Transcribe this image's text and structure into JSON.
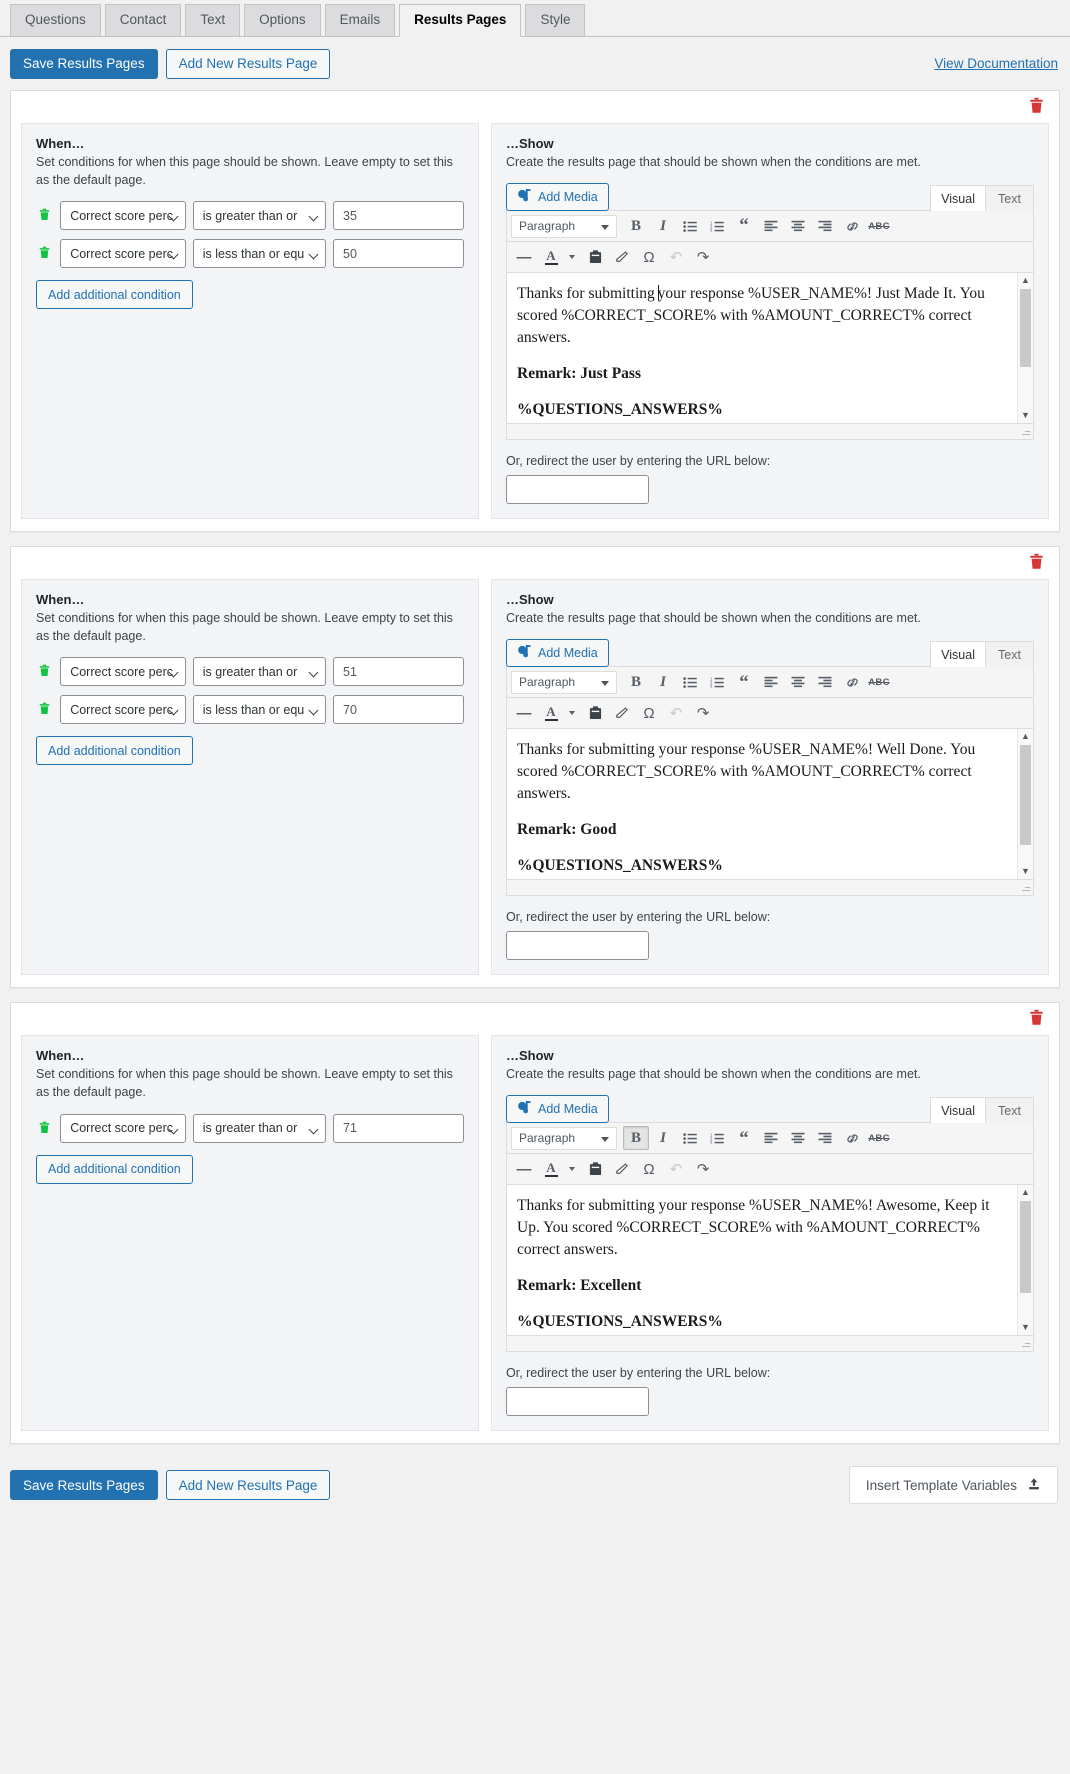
{
  "tabs": [
    {
      "label": "Questions",
      "active": false
    },
    {
      "label": "Contact",
      "active": false
    },
    {
      "label": "Text",
      "active": false
    },
    {
      "label": "Options",
      "active": false
    },
    {
      "label": "Emails",
      "active": false
    },
    {
      "label": "Results Pages",
      "active": true
    },
    {
      "label": "Style",
      "active": false
    }
  ],
  "toolbar": {
    "save_label": "Save Results Pages",
    "add_new_label": "Add New Results Page",
    "doc_link_label": "View Documentation"
  },
  "footer": {
    "save_label": "Save Results Pages",
    "add_new_label": "Add New Results Page",
    "insert_vars_label": "Insert Template Variables"
  },
  "labels": {
    "when_title": "When…",
    "when_desc": "Set conditions for when this page should be shown. Leave empty to set this as the default page.",
    "show_title": "…Show",
    "show_desc": "Create the results page that should be shown when the conditions are met.",
    "add_condition": "Add additional condition",
    "add_media": "Add Media",
    "tab_visual": "Visual",
    "tab_text": "Text",
    "format_select": "Paragraph",
    "redirect_label": "Or, redirect the user by entering the URL below:",
    "redirect_value": "",
    "delete_icon": "trash-icon"
  },
  "editor_buttons": [
    {
      "name": "bold-button",
      "glyph": "B",
      "kind": "bold"
    },
    {
      "name": "italic-button",
      "glyph": "I",
      "kind": "italic"
    },
    {
      "name": "bulleted-list-button",
      "glyph": "ul",
      "kind": "ul"
    },
    {
      "name": "numbered-list-button",
      "glyph": "ol",
      "kind": "ol"
    },
    {
      "name": "blockquote-button",
      "glyph": "“",
      "kind": "quote"
    },
    {
      "name": "align-left-button",
      "glyph": "al",
      "kind": "align-left"
    },
    {
      "name": "align-center-button",
      "glyph": "ac",
      "kind": "align-center"
    },
    {
      "name": "align-right-button",
      "glyph": "ar",
      "kind": "align-right"
    },
    {
      "name": "insert-link-button",
      "glyph": "link",
      "kind": "link"
    },
    {
      "name": "strikethrough-button",
      "glyph": "ABC",
      "kind": "abc"
    }
  ],
  "editor_buttons_row2": [
    {
      "name": "horizontal-rule-button",
      "glyph": "—",
      "kind": "dash"
    },
    {
      "name": "text-color-button",
      "glyph": "A",
      "kind": "textcolor"
    },
    {
      "name": "paste-as-text-button",
      "glyph": "clip",
      "kind": "paste"
    },
    {
      "name": "clear-formatting-button",
      "glyph": "eraser",
      "kind": "eraser"
    },
    {
      "name": "special-character-button",
      "glyph": "Ω",
      "kind": "omega"
    },
    {
      "name": "undo-button",
      "glyph": "↶",
      "kind": "undo"
    },
    {
      "name": "redo-button",
      "glyph": "↷",
      "kind": "redo"
    }
  ],
  "condition_operators": [
    "is greater than or",
    "is less than or equ"
  ],
  "results_pages": [
    {
      "conditions": [
        {
          "field": "Correct score perc",
          "operator": "is greater than or",
          "value": "35"
        },
        {
          "field": "Correct score perc",
          "operator": "is less than or equ",
          "value": "50"
        }
      ],
      "content": {
        "line1_a": "Thanks for submitting ",
        "line1_b": "your response %USER_NAME%! Just Made It. You scored %CORRECT_SCORE% with %AMOUNT_CORRECT% correct answers.",
        "remark": "Remark: Just Pass",
        "variable": "%QUESTIONS_ANSWERS%"
      },
      "bold_active": false,
      "scroll_thumb_top": 0,
      "scroll_thumb_height": 78
    },
    {
      "conditions": [
        {
          "field": "Correct score perc",
          "operator": "is greater than or",
          "value": "51"
        },
        {
          "field": "Correct score perc",
          "operator": "is less than or equ",
          "value": "70"
        }
      ],
      "content": {
        "line1_a": "",
        "line1_b": "Thanks for submitting your response %USER_NAME%! Well Done. You scored %CORRECT_SCORE% with %AMOUNT_CORRECT% correct answers.",
        "remark": "Remark: Good",
        "variable": "%QUESTIONS_ANSWERS%"
      },
      "bold_active": false,
      "scroll_thumb_top": 0,
      "scroll_thumb_height": 100
    },
    {
      "conditions": [
        {
          "field": "Correct score perc",
          "operator": "is greater than or",
          "value": "71"
        }
      ],
      "content": {
        "line1_a": "",
        "line1_b": "Thanks for submitting your response %USER_NAME%! Awesome, Keep it Up. You scored %CORRECT_SCORE% with %AMOUNT_CORRECT% correct answers.",
        "remark": "Remark: Excellent",
        "variable": "%QUESTIONS_ANSWERS%"
      },
      "bold_active": true,
      "scroll_thumb_top": 0,
      "scroll_thumb_height": 92
    }
  ],
  "colors": {
    "accent": "#2271b1",
    "danger": "#d63638",
    "trash_small": "#12c244"
  }
}
